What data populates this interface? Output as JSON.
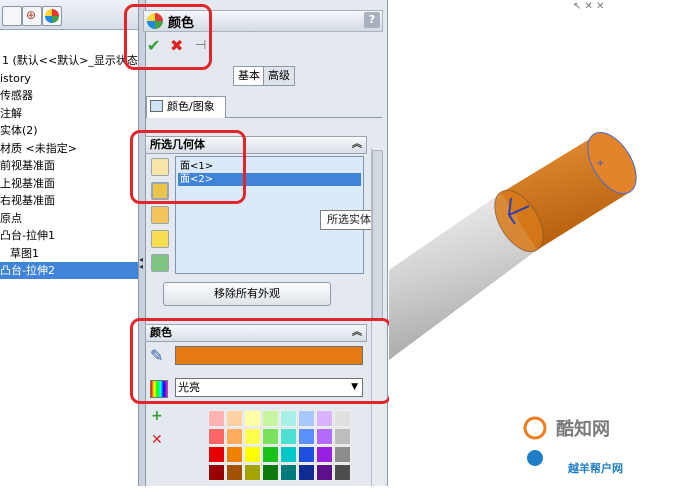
{
  "tree": {
    "items": [
      {
        "label": "1 (默认<<默认>_显示状态",
        "selected": false
      },
      {
        "label": "istory",
        "selected": false
      },
      {
        "label": "传感器",
        "selected": false
      },
      {
        "label": "注解",
        "selected": false
      },
      {
        "label": "实体(2)",
        "selected": false
      },
      {
        "label": "材质 <未指定>",
        "selected": false
      },
      {
        "label": "前视基准面",
        "selected": false
      },
      {
        "label": "上视基准面",
        "selected": false
      },
      {
        "label": "右视基准面",
        "selected": false
      },
      {
        "label": "原点",
        "selected": false
      },
      {
        "label": "凸台-拉伸1",
        "selected": false
      },
      {
        "label": "草图1",
        "selected": false
      },
      {
        "label": "凸台-拉伸2",
        "selected": true
      }
    ]
  },
  "pm": {
    "title": "颜色",
    "help": "?",
    "ok_icon": "✔",
    "cancel_icon": "✖",
    "pin_icon": "⊣",
    "tabs_basic": "基本",
    "tabs_advanced": "高级",
    "tab_label": "颜色/图象",
    "selected_geometry": {
      "header": "所选几何体",
      "chevron": "︽",
      "rows": [
        {
          "label": "面<1>",
          "selected": false
        },
        {
          "label": "面<2>",
          "selected": true
        }
      ],
      "tooltip": "所选实体",
      "remove_button": "移除所有外观"
    },
    "color": {
      "header": "颜色",
      "chevron": "︽",
      "swatch_color": "#e67a12",
      "finish": "光亮"
    }
  },
  "watermark": {
    "line1": "酷知网",
    "line2": "越羊帮户网"
  },
  "colors": {
    "annotation": "#e0262b",
    "cylinder_body": "#d9d9d9",
    "cylinder_cap": "#d97a1a",
    "selection": "#3f84d8"
  },
  "icons": [
    "search-icon",
    "color-wheel-icon",
    "check-icon",
    "close-icon",
    "pin-icon",
    "eyedropper-icon",
    "palette-icon",
    "add-icon",
    "delete-icon"
  ]
}
